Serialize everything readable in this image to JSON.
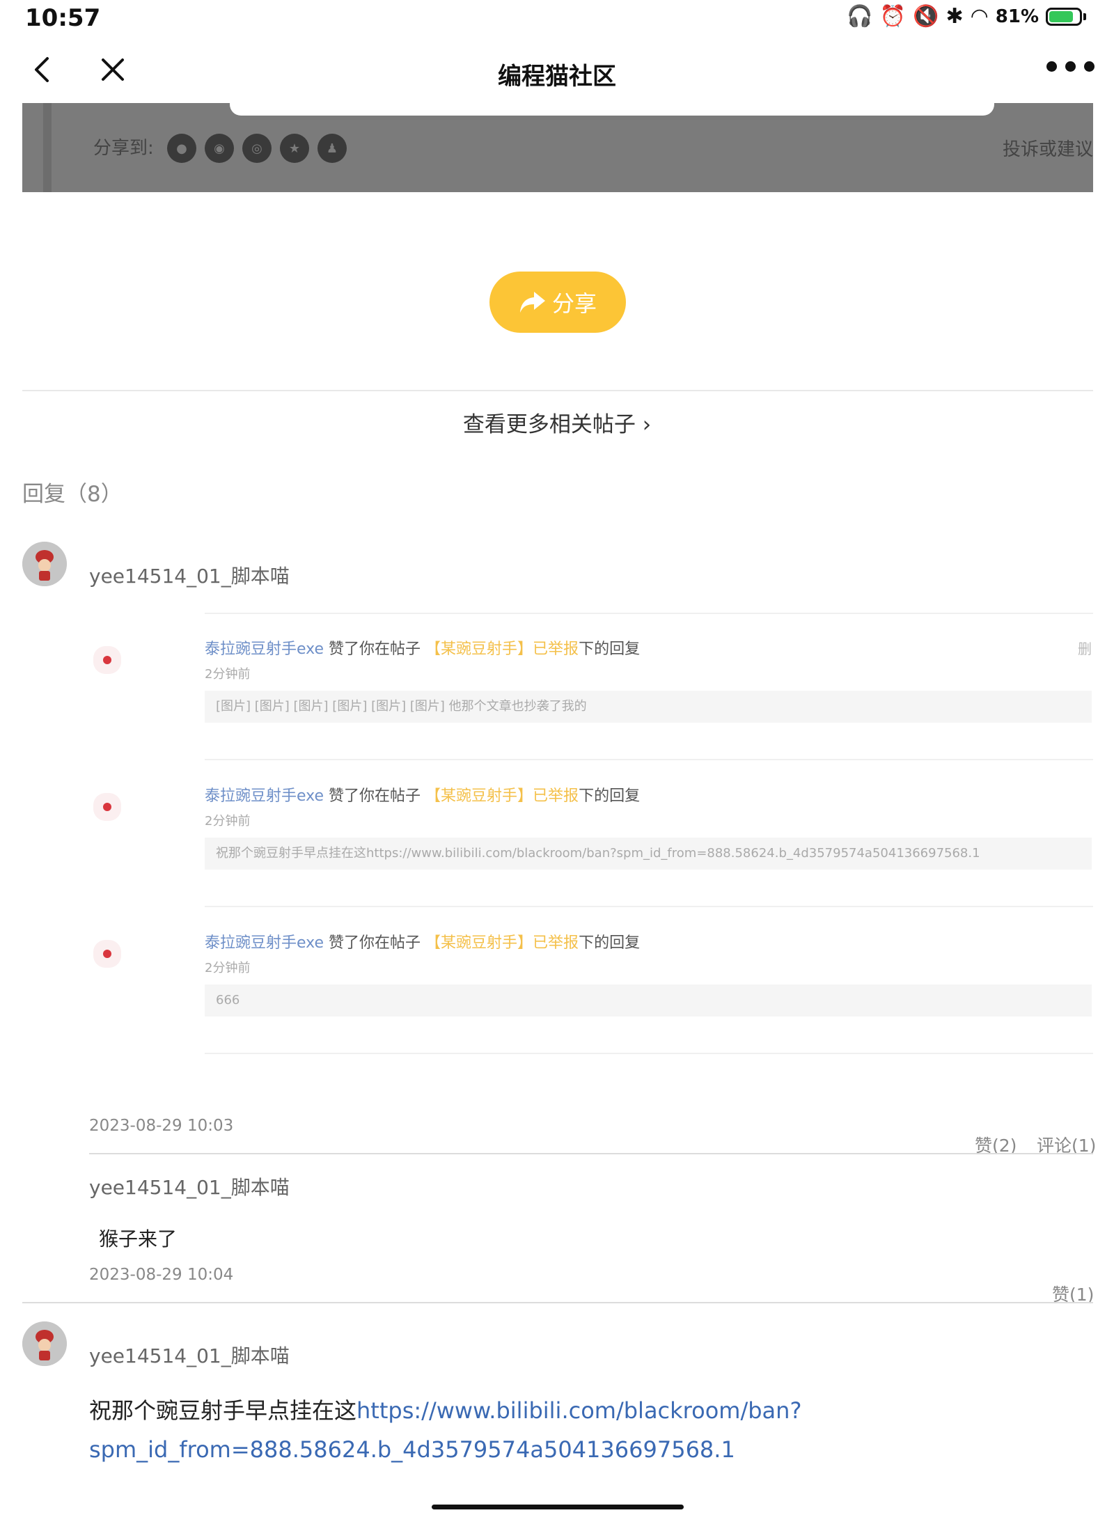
{
  "status_bar": {
    "time": "10:57",
    "battery": "81%",
    "battery_level": 0.81
  },
  "nav": {
    "title": "编程猫社区"
  },
  "share_strip": {
    "label": "分享到:",
    "report": "投诉或建议"
  },
  "share_button": {
    "label": "分享"
  },
  "more_posts": {
    "label": "查看更多相关帖子"
  },
  "replies": {
    "count_label": "回复（8）",
    "first": {
      "username": "yee14514_01_脚本喵",
      "notices": [
        {
          "user": "泰拉豌豆射手exe",
          "action": "赞了你在帖子",
          "post": "【某豌豆射手】已举报",
          "suffix": "下的回复",
          "time": "2分钟前",
          "content": "[图片] [图片] [图片] [图片] [图片] [图片] 他那个文章也抄袭了我的",
          "delete": "删"
        },
        {
          "user": "泰拉豌豆射手exe",
          "action": "赞了你在帖子",
          "post": "【某豌豆射手】已举报",
          "suffix": "下的回复",
          "time": "2分钟前",
          "content": "祝那个豌豆射手早点挂在这https://www.bilibili.com/blackroom/ban?spm_id_from=888.58624.b_4d3579574a504136697568.1"
        },
        {
          "user": "泰拉豌豆射手exe",
          "action": "赞了你在帖子",
          "post": "【某豌豆射手】已举报",
          "suffix": "下的回复",
          "time": "2分钟前",
          "content": "666"
        }
      ],
      "timestamp": "2023-08-29 10:03",
      "likes": "赞(2)",
      "comments": "评论(1)",
      "sub_reply": {
        "username": "yee14514_01_脚本喵",
        "text": "猴子来了",
        "timestamp": "2023-08-29 10:04",
        "likes": "赞(1)"
      }
    },
    "second": {
      "username": "yee14514_01_脚本喵",
      "text": "祝那个豌豆射手早点挂在这",
      "link_line1": "https://www.bilibili.com/blackroom/ban?",
      "link_line2": "spm_id_from=888.58624.b_4d3579574a504136697568.1"
    }
  }
}
